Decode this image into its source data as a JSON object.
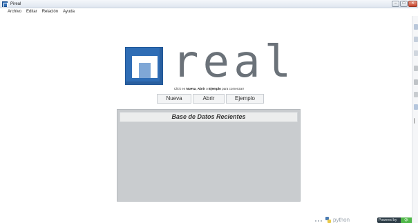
{
  "window": {
    "title": "Pireal",
    "minimize_label": "–",
    "maximize_label": "□",
    "close_label": "✕"
  },
  "menu": {
    "items": [
      {
        "label": "Archivo"
      },
      {
        "label": "Editar"
      },
      {
        "label": "Relación"
      },
      {
        "label": "Ayuda"
      }
    ]
  },
  "logo": {
    "wordmark": "real",
    "brand_color": "#2f6db5"
  },
  "main": {
    "instruction_prefix": "Click en ",
    "instruction_new": "Nueva",
    "instruction_sep": ", ",
    "instruction_open": "Abrir",
    "instruction_or": " o ",
    "instruction_example": "Ejemplo",
    "instruction_suffix": " para comenzar!",
    "buttons": {
      "new": "Nueva",
      "open": "Abrir",
      "example": "Ejemplo"
    }
  },
  "recent": {
    "title": "Base de Datos Recientes",
    "items": []
  },
  "footer": {
    "python_text": "python",
    "badge_text": "Powered by",
    "badge_end": "Qt"
  },
  "sidebar": {
    "icons": [
      "panel-icon",
      "panel-icon",
      "panel-icon",
      "table-icon",
      "table-icon",
      "table-icon",
      "list-icon",
      "edit-icon"
    ]
  }
}
